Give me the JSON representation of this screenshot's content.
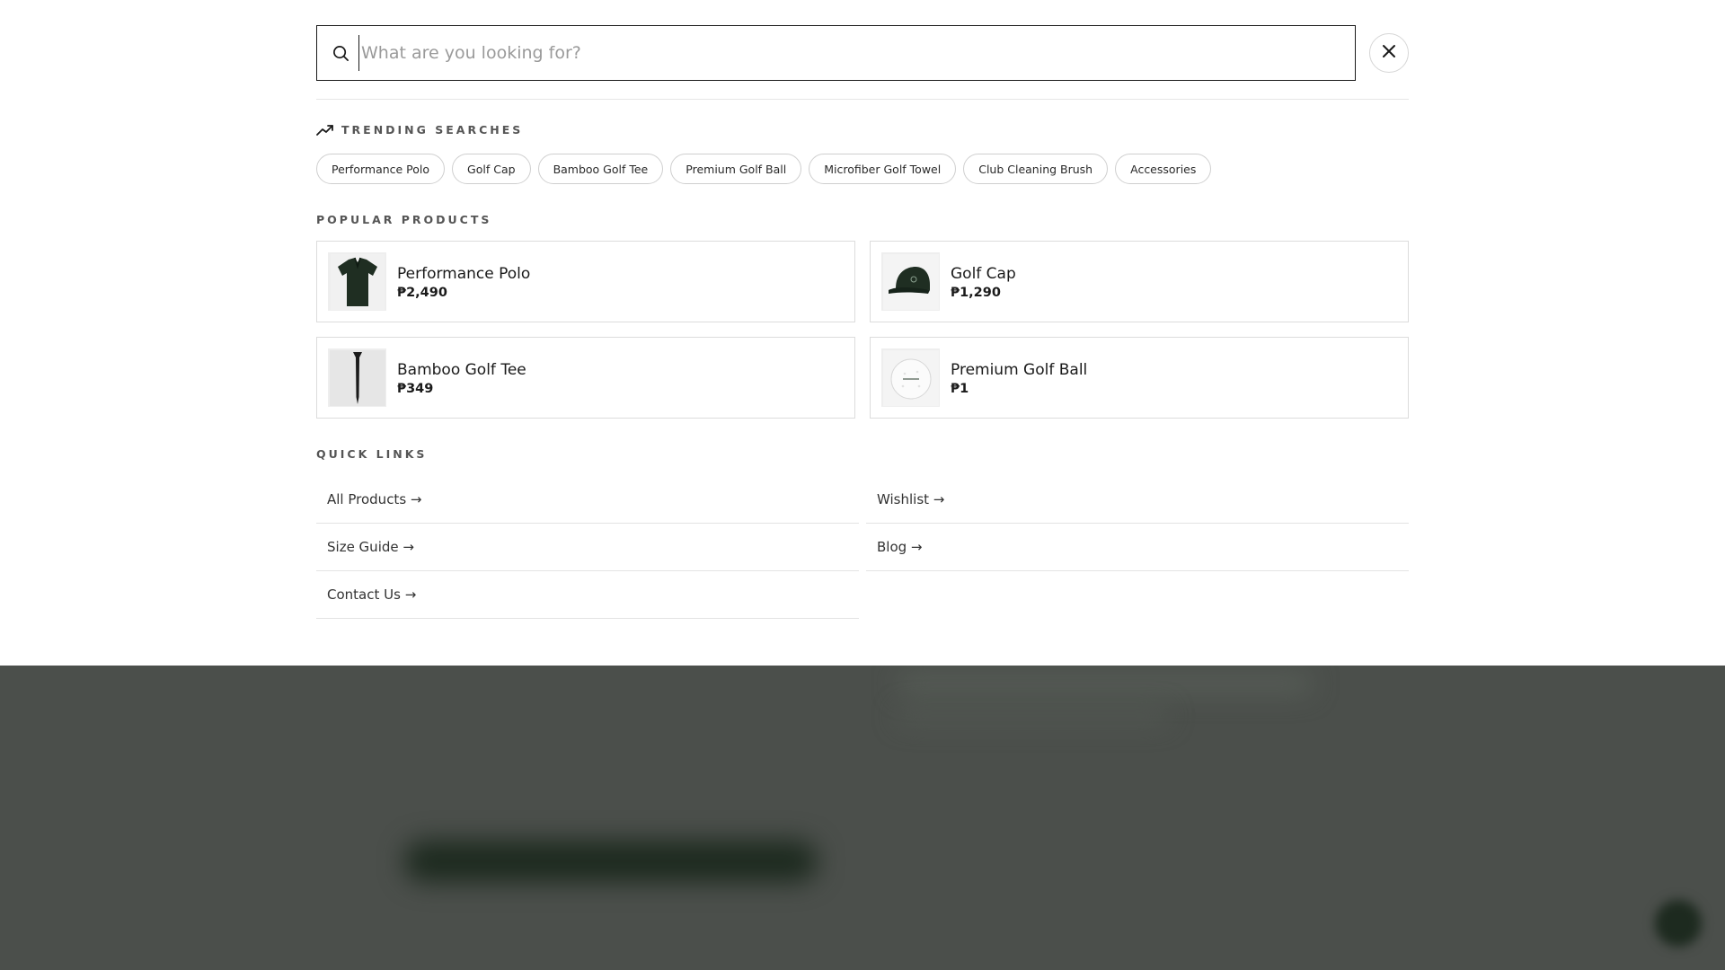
{
  "search": {
    "placeholder": "What are you looking for?",
    "value": ""
  },
  "trending": {
    "title": "TRENDING SEARCHES",
    "items": [
      "Performance Polo",
      "Golf Cap",
      "Bamboo Golf Tee",
      "Premium Golf Ball",
      "Microfiber Golf Towel",
      "Club Cleaning Brush",
      "Accessories"
    ]
  },
  "popular": {
    "title": "POPULAR PRODUCTS",
    "products": [
      {
        "name": "Performance Polo",
        "price": "₱2,490",
        "thumb_icon": "polo-shirt-icon"
      },
      {
        "name": "Golf Cap",
        "price": "₱1,290",
        "thumb_icon": "cap-icon"
      },
      {
        "name": "Bamboo Golf Tee",
        "price": "₱349",
        "thumb_icon": "golf-tee-icon"
      },
      {
        "name": "Premium Golf Ball",
        "price": "₱1",
        "thumb_icon": "golf-ball-icon"
      }
    ]
  },
  "quick_links": {
    "title": "QUICK LINKS",
    "items": [
      "All Products →",
      "Wishlist →",
      "Size Guide →",
      "Blog →",
      "Contact Us →"
    ]
  },
  "colors": {
    "brand_green": "#1d2a1f",
    "overlay_backdrop": "#4b4f4b"
  }
}
